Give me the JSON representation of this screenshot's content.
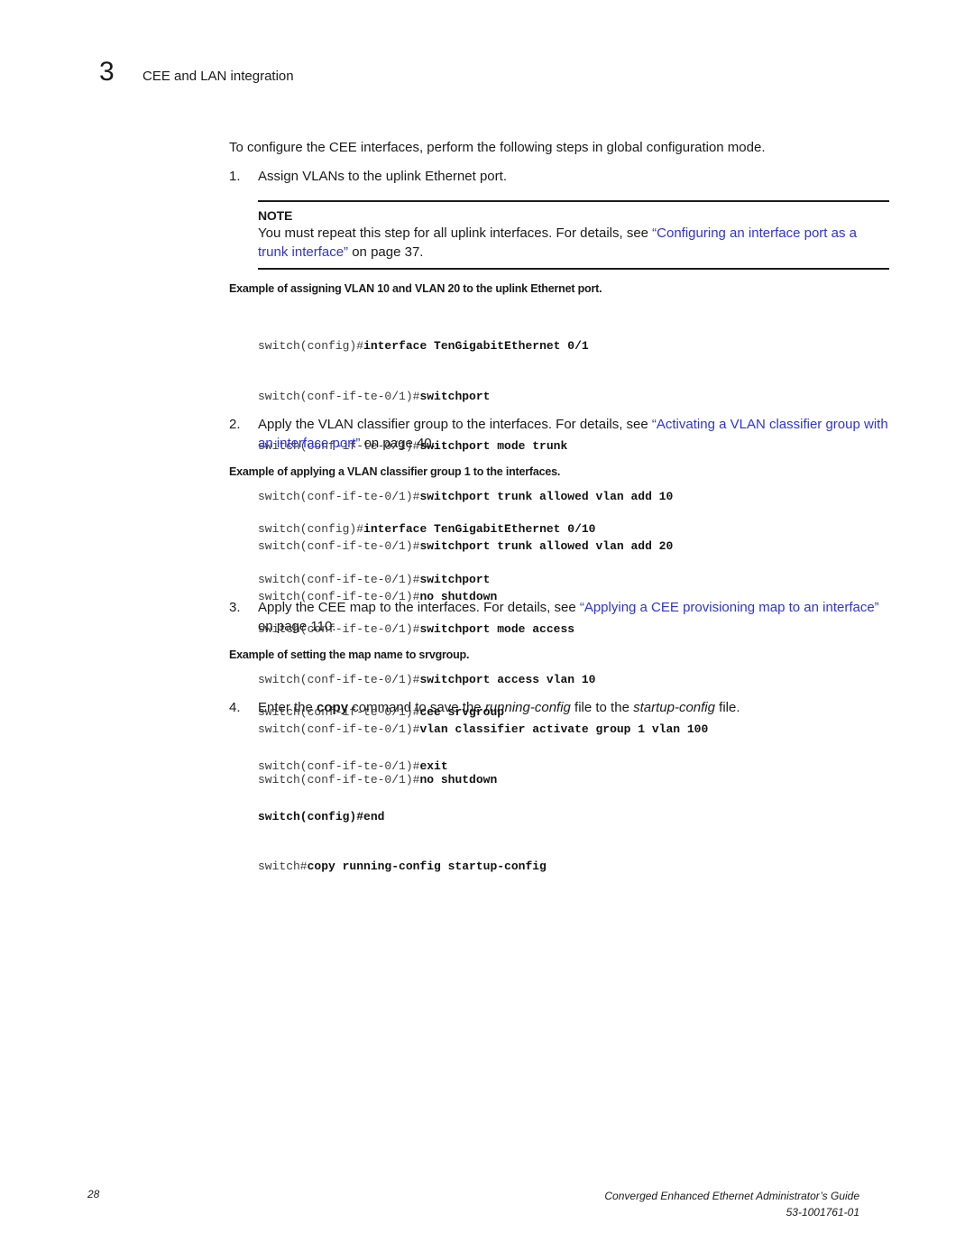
{
  "header": {
    "chapter_number": "3",
    "chapter_title": "CEE and LAN integration"
  },
  "intro": "To configure the CEE interfaces, perform the following steps in global configuration mode.",
  "steps": [
    {
      "num": "1.",
      "text": "Assign VLANs to the uplink Ethernet port.",
      "note": {
        "label": "NOTE",
        "text_before": "You must repeat this step for all uplink interfaces. For details, see ",
        "link": "“Configuring an interface port as a trunk interface”",
        "text_after": " on page 37."
      },
      "example_caption": "Example  of assigning VLAN 10 and VLAN 20 to the uplink Ethernet port.",
      "code": [
        {
          "prompt": "switch(config)#",
          "cmd": "interface TenGigabitEthernet 0/1"
        },
        {
          "prompt": "switch(conf-if-te-0/1)#",
          "cmd": "switchport"
        },
        {
          "prompt": "switch(conf-if-te-0/1)#",
          "cmd": "switchport mode trunk"
        },
        {
          "prompt": "switch(conf-if-te-0/1)#",
          "cmd": "switchport trunk allowed vlan add 10"
        },
        {
          "prompt": "switch(conf-if-te-0/1)#",
          "cmd": "switchport trunk allowed vlan add 20"
        },
        {
          "prompt": "switch(conf-if-te-0/1)#",
          "cmd": "no shutdown"
        }
      ]
    },
    {
      "num": "2.",
      "text_before": "Apply the VLAN classifier group to the interfaces. For details, see ",
      "link": "“Activating a VLAN classifier group with an interface port”",
      "text_after": " on page 40.",
      "example_caption": "Example  of applying a VLAN classifier group 1 to the interfaces.",
      "code": [
        {
          "prompt": "switch(config)#",
          "cmd": "interface TenGigabitEthernet 0/10"
        },
        {
          "prompt": "switch(conf-if-te-0/1)#",
          "cmd": "switchport"
        },
        {
          "prompt": "switch(conf-if-te-0/1)#",
          "cmd": "switchport mode access"
        },
        {
          "prompt": "switch(conf-if-te-0/1)#",
          "cmd": "switchport access vlan 10"
        },
        {
          "prompt": "switch(conf-if-te-0/1)#",
          "cmd": "vlan classifier activate group 1 vlan 100"
        },
        {
          "prompt": "switch(conf-if-te-0/1)#",
          "cmd": "no shutdown"
        }
      ]
    },
    {
      "num": "3.",
      "text_before": "Apply the CEE map to the interfaces. For details, see ",
      "link": "“Applying a CEE provisioning map to an interface”",
      "text_after": " on page 110.",
      "example_caption": "Example  of setting the map name to srvgroup.",
      "code": [
        {
          "prompt": "switch(conf-if-te-0/1)#",
          "cmd": "cee srvgroup"
        }
      ]
    },
    {
      "num": "4.",
      "t1": "Enter the ",
      "bold": "copy",
      "t2": " command to save the ",
      "italic1": "running-config",
      "t3": " file to the ",
      "italic2": "startup-config",
      "t4": " file.",
      "code": [
        {
          "prompt": "switch(conf-if-te-0/1)#",
          "cmd": "exit"
        },
        {
          "prompt": "",
          "cmd": "switch(config)#end"
        },
        {
          "prompt": "switch#",
          "cmd": "copy running-config startup-config"
        }
      ]
    }
  ],
  "footer": {
    "page_number": "28",
    "book_title": "Converged Enhanced Ethernet Administrator’s Guide",
    "doc_number": "53-1001761-01"
  },
  "colors": {
    "link": "#2f33d9",
    "text": "#1a1a1a"
  }
}
